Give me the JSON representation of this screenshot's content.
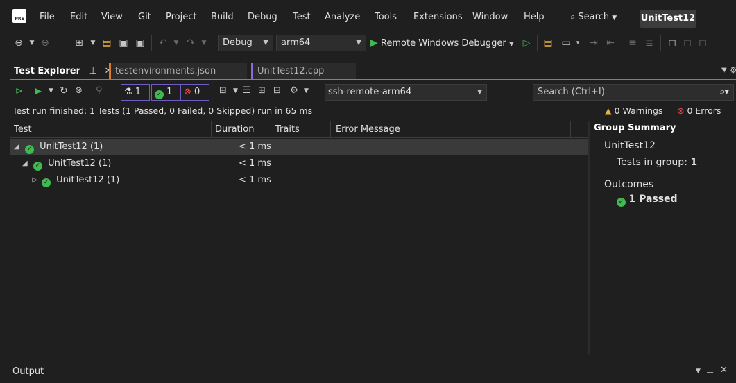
{
  "menubar": {
    "logo_text": "PRE",
    "items": [
      "File",
      "Edit",
      "View",
      "Git",
      "Project",
      "Build",
      "Debug",
      "Test",
      "Analyze",
      "Tools",
      "Extensions",
      "Window",
      "Help"
    ],
    "search_label": "Search",
    "solution_name": "UnitTest12"
  },
  "toolbar": {
    "configuration": "Debug",
    "platform": "arm64",
    "debug_target": "Remote Windows Debugger"
  },
  "tabs": [
    {
      "label": "Test Explorer",
      "active": true
    },
    {
      "label": "testenvironments.json",
      "active": false
    },
    {
      "label": "UnitTest12.cpp",
      "active": false
    }
  ],
  "test_explorer": {
    "filter_all_count": "1",
    "filter_passed_count": "1",
    "filter_failed_count": "0",
    "environment": "ssh-remote-arm64",
    "search_placeholder": "Search (Ctrl+I)",
    "status_text": "Test run finished: 1 Tests (1 Passed, 0 Failed, 0 Skipped) run in 65 ms",
    "warnings": "0 Warnings",
    "errors": "0 Errors",
    "columns": [
      "Test",
      "Duration",
      "Traits",
      "Error Message"
    ],
    "rows": [
      {
        "name": "UnitTest12 (1)",
        "duration": "< 1 ms",
        "level": 0,
        "expanded": true,
        "selected": true
      },
      {
        "name": "UnitTest12 (1)",
        "duration": "< 1 ms",
        "level": 1,
        "expanded": true,
        "selected": false
      },
      {
        "name": "UnitTest12 (1)",
        "duration": "< 1 ms",
        "level": 2,
        "expanded": false,
        "selected": false
      }
    ]
  },
  "group_summary": {
    "title": "Group Summary",
    "group_name": "UnitTest12",
    "tests_in_group_label": "Tests in group",
    "tests_in_group_value": "1",
    "outcomes_label": "Outcomes",
    "passed_text": "1 Passed"
  },
  "output_panel": {
    "title": "Output"
  },
  "colors": {
    "accent_purple": "#8a6cd9",
    "pass_green": "#3fb950",
    "error_red": "#f14c4c",
    "warning_yellow": "#e8b33a"
  }
}
